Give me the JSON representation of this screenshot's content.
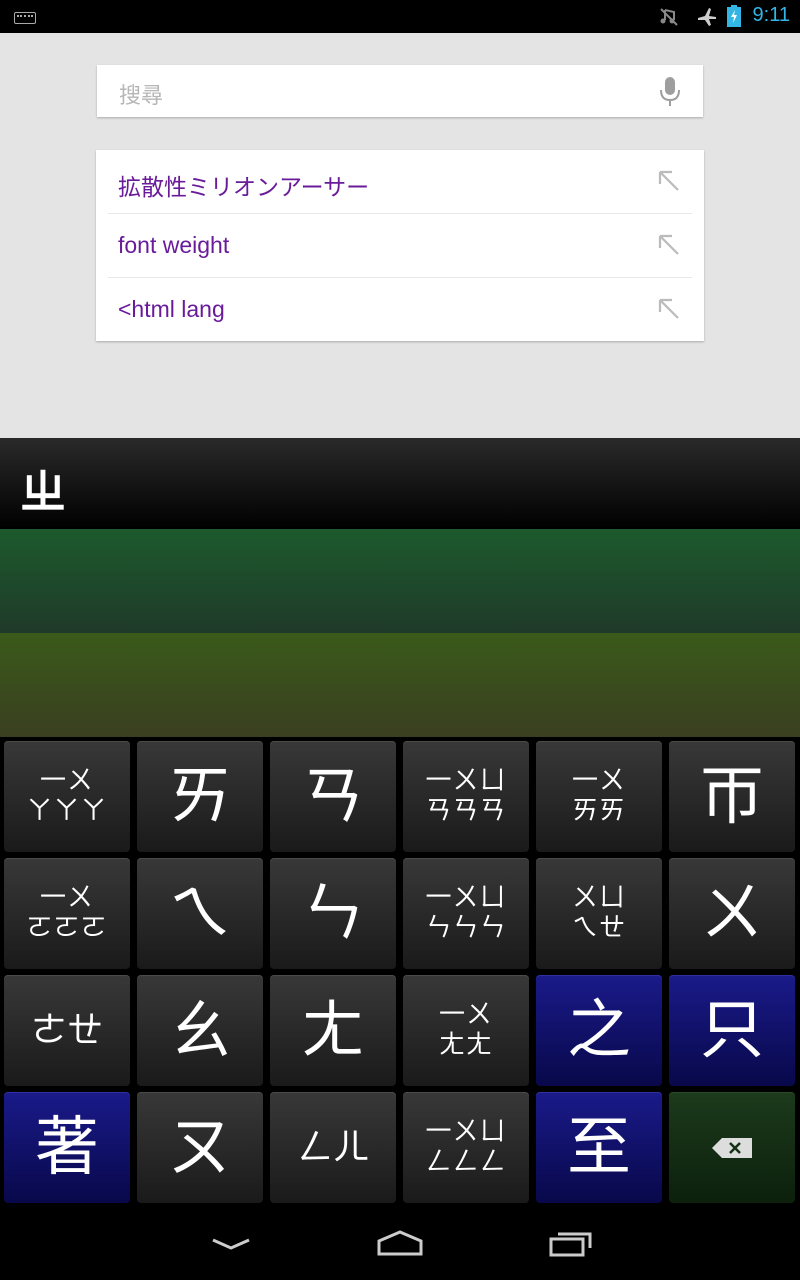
{
  "status_bar": {
    "time": "9:11",
    "icons": [
      "keyboard-icon",
      "mute-icon",
      "airplane-mode-icon",
      "battery-charging-icon"
    ],
    "accent_color": "#33b5e5"
  },
  "search": {
    "placeholder": "搜尋",
    "mic_icon": "microphone-icon"
  },
  "suggestions": [
    {
      "text": "拡散性ミリオンアーサー",
      "icon": "arrow-up-left-icon"
    },
    {
      "text": "font weight",
      "icon": "arrow-up-left-icon"
    },
    {
      "text": "<html lang",
      "icon": "arrow-up-left-icon"
    }
  ],
  "composing": {
    "text": "ㄓ"
  },
  "keyboard": {
    "rows": [
      [
        {
          "label": "一ㄨ\nㄚㄚㄚ",
          "style": "sm",
          "color": "dark"
        },
        {
          "label": "ㄞ",
          "style": "big",
          "color": "dark"
        },
        {
          "label": "ㄢ",
          "style": "big",
          "color": "dark"
        },
        {
          "label": "一ㄨㄩ\nㄢㄢㄢ",
          "style": "sm",
          "color": "dark"
        },
        {
          "label": "一ㄨ\nㄞㄞ",
          "style": "sm",
          "color": "dark"
        },
        {
          "label": "帀",
          "style": "big",
          "color": "dark"
        }
      ],
      [
        {
          "label": "一ㄨ\nㄛㄛㄛ",
          "style": "sm",
          "color": "dark"
        },
        {
          "label": "ㄟ",
          "style": "big",
          "color": "dark"
        },
        {
          "label": "ㄣ",
          "style": "big",
          "color": "dark"
        },
        {
          "label": "一ㄨㄩ\nㄣㄣㄣ",
          "style": "sm",
          "color": "dark"
        },
        {
          "label": "ㄨㄩ\nㄟㄝ",
          "style": "sm",
          "color": "dark"
        },
        {
          "label": "ㄨ",
          "style": "big",
          "color": "dark"
        }
      ],
      [
        {
          "label": "ㄜㄝ",
          "style": "mid",
          "color": "dark"
        },
        {
          "label": "ㄠ",
          "style": "big",
          "color": "dark"
        },
        {
          "label": "ㄤ",
          "style": "big",
          "color": "dark"
        },
        {
          "label": "一ㄨ\nㄤㄤ",
          "style": "sm",
          "color": "dark"
        },
        {
          "label": "之",
          "style": "big",
          "color": "blue"
        },
        {
          "label": "只",
          "style": "big",
          "color": "blue"
        }
      ],
      [
        {
          "label": "著",
          "style": "big",
          "color": "blue"
        },
        {
          "label": "ㄡ",
          "style": "big",
          "color": "dark"
        },
        {
          "label": "ㄥㄦ",
          "style": "mid",
          "color": "dark"
        },
        {
          "label": "一ㄨㄩ\nㄥㄥㄥ",
          "style": "sm",
          "color": "dark"
        },
        {
          "label": "至",
          "style": "big",
          "color": "blue"
        },
        {
          "label": "",
          "style": "icon",
          "color": "green",
          "icon": "backspace-icon"
        }
      ]
    ],
    "colors": {
      "dark": "#2a2a2a",
      "blue": "#10106a",
      "green": "#163016"
    }
  },
  "nav_bar": {
    "buttons": [
      "back-down-icon",
      "home-icon",
      "recent-apps-icon"
    ]
  }
}
